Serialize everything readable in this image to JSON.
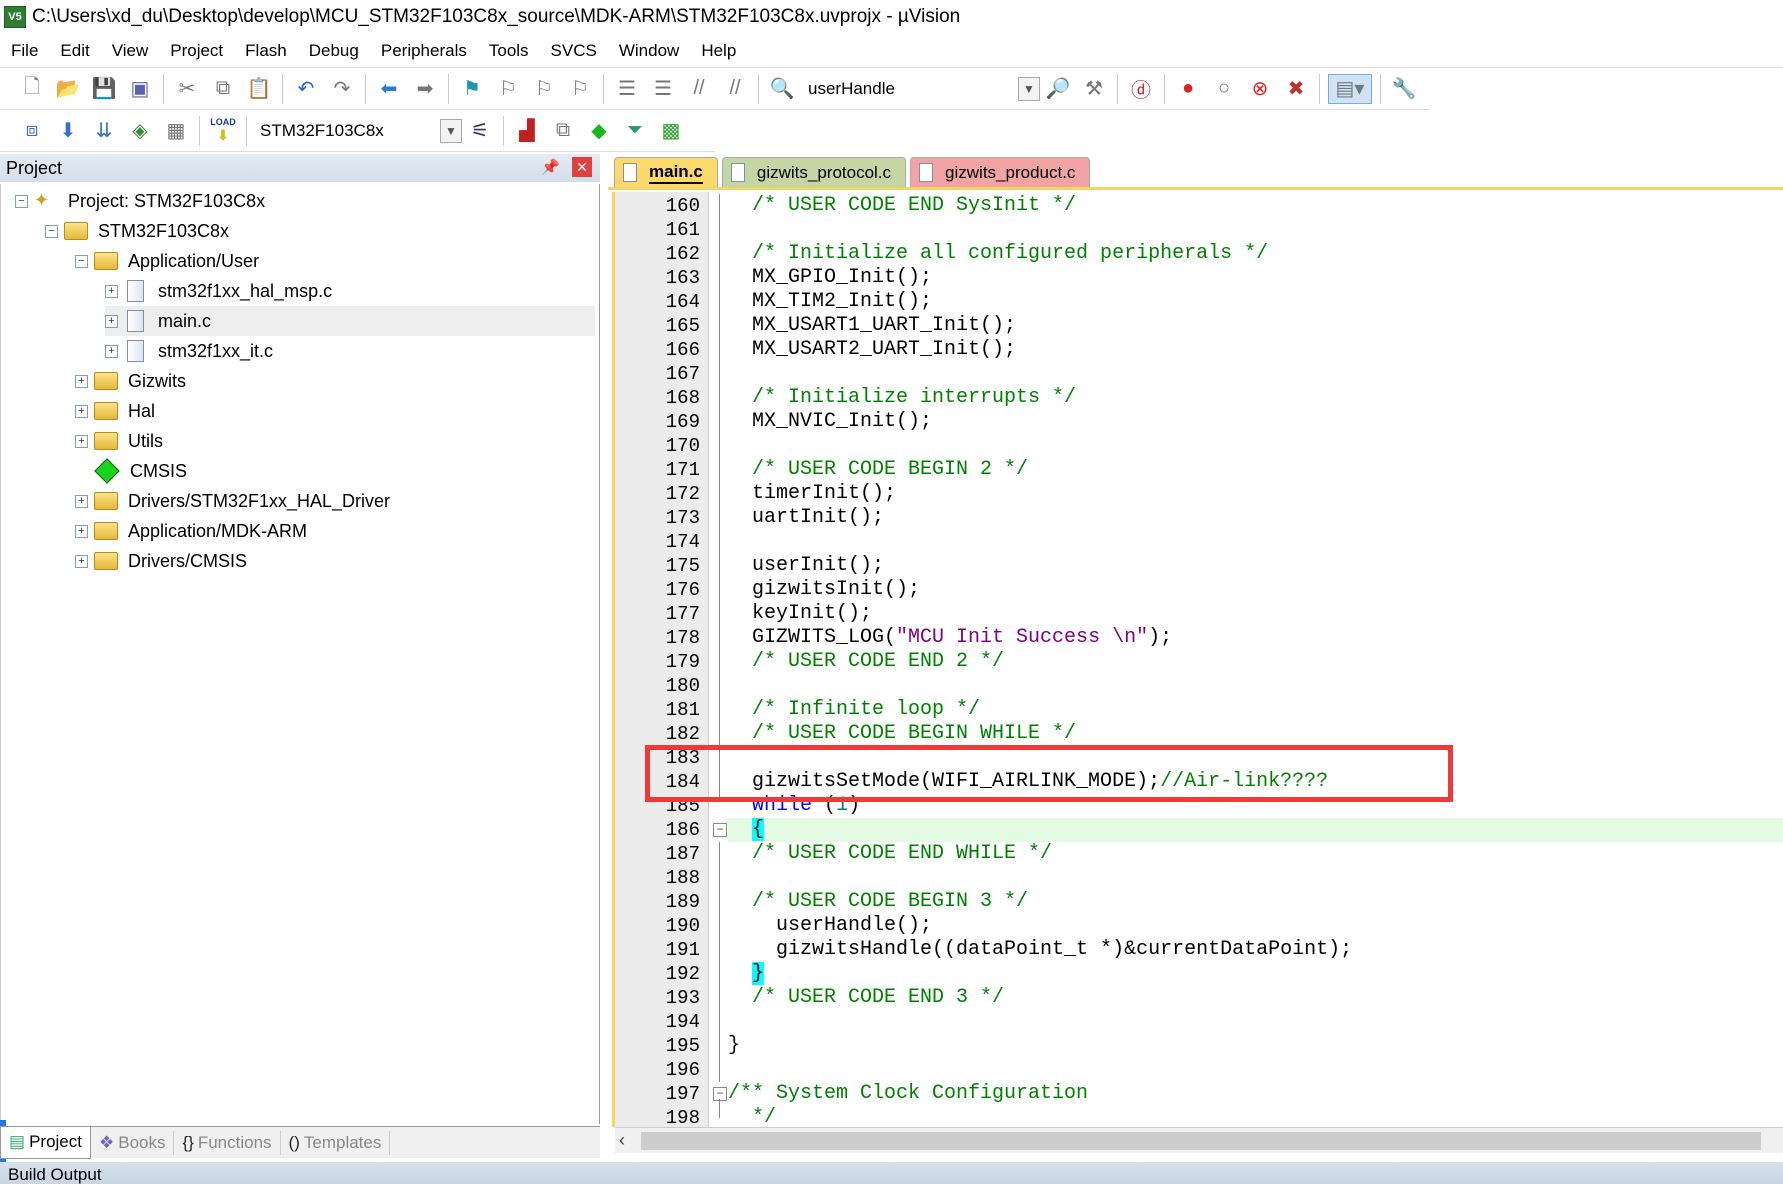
{
  "window": {
    "title": "C:\\Users\\xd_du\\Desktop\\develop\\MCU_STM32F103C8x_source\\MDK-ARM\\STM32F103C8x.uvprojx - µVision",
    "logo": "V5"
  },
  "menu": [
    "File",
    "Edit",
    "View",
    "Project",
    "Flash",
    "Debug",
    "Peripherals",
    "Tools",
    "SVCS",
    "Window",
    "Help"
  ],
  "toolbar1": {
    "find_combo": "userHandle"
  },
  "toolbar2": {
    "target_combo": "STM32F103C8x",
    "load_label": "LOAD"
  },
  "project_panel": {
    "title": "Project",
    "tree": [
      {
        "label": "Project: STM32F103C8x",
        "level": 0,
        "icon": "project-icon",
        "expander": "minus"
      },
      {
        "label": "STM32F103C8x",
        "level": 1,
        "icon": "target-folder-icon",
        "expander": "minus"
      },
      {
        "label": "Application/User",
        "level": 2,
        "icon": "folder-open-icon",
        "expander": "minus"
      },
      {
        "label": "stm32f1xx_hal_msp.c",
        "level": 3,
        "icon": "file-icon",
        "expander": "plus"
      },
      {
        "label": "main.c",
        "level": 3,
        "icon": "file-icon",
        "expander": "plus",
        "selected": true
      },
      {
        "label": "stm32f1xx_it.c",
        "level": 3,
        "icon": "file-icon",
        "expander": "plus"
      },
      {
        "label": "Gizwits",
        "level": 2,
        "icon": "folder-icon",
        "expander": "plus"
      },
      {
        "label": "Hal",
        "level": 2,
        "icon": "folder-icon",
        "expander": "plus"
      },
      {
        "label": "Utils",
        "level": 2,
        "icon": "folder-icon",
        "expander": "plus"
      },
      {
        "label": "CMSIS",
        "level": 2,
        "icon": "cmsis-diamond-icon",
        "expander": "none"
      },
      {
        "label": "Drivers/STM32F1xx_HAL_Driver",
        "level": 2,
        "icon": "folder-icon",
        "expander": "plus"
      },
      {
        "label": "Application/MDK-ARM",
        "level": 2,
        "icon": "folder-icon",
        "expander": "plus"
      },
      {
        "label": "Drivers/CMSIS",
        "level": 2,
        "icon": "folder-icon",
        "expander": "plus"
      }
    ],
    "bottom_tabs": [
      {
        "label": "Project",
        "icon": "project-tab-icon",
        "active": true
      },
      {
        "label": "Books",
        "icon": "books-icon"
      },
      {
        "label": "Functions",
        "icon": "braces-icon"
      },
      {
        "label": "Templates",
        "icon": "templates-icon"
      }
    ]
  },
  "editor_tabs": [
    {
      "label": "main.c",
      "color": "#fbd96b",
      "active": true
    },
    {
      "label": "gizwits_protocol.c",
      "color": "#c3d6a4"
    },
    {
      "label": "gizwits_product.c",
      "color": "#f2a3a3"
    }
  ],
  "code": [
    {
      "n": "160",
      "tokens": [
        [
          "  /* USER CODE END SysInit */",
          "comment"
        ]
      ]
    },
    {
      "n": "161",
      "tokens": []
    },
    {
      "n": "162",
      "tokens": [
        [
          "  /* Initialize all configured peripherals */",
          "comment"
        ]
      ]
    },
    {
      "n": "163",
      "tokens": [
        [
          "  MX_GPIO_Init();",
          ""
        ]
      ]
    },
    {
      "n": "164",
      "tokens": [
        [
          "  MX_TIM2_Init();",
          ""
        ]
      ]
    },
    {
      "n": "165",
      "tokens": [
        [
          "  MX_USART1_UART_Init();",
          ""
        ]
      ]
    },
    {
      "n": "166",
      "tokens": [
        [
          "  MX_USART2_UART_Init();",
          ""
        ]
      ]
    },
    {
      "n": "167",
      "tokens": []
    },
    {
      "n": "168",
      "tokens": [
        [
          "  /* Initialize interrupts */",
          "comment"
        ]
      ]
    },
    {
      "n": "169",
      "tokens": [
        [
          "  MX_NVIC_Init();",
          ""
        ]
      ]
    },
    {
      "n": "170",
      "tokens": []
    },
    {
      "n": "171",
      "tokens": [
        [
          "  /* USER CODE BEGIN 2 */",
          "comment"
        ]
      ]
    },
    {
      "n": "172",
      "tokens": [
        [
          "  timerInit();",
          ""
        ]
      ]
    },
    {
      "n": "173",
      "tokens": [
        [
          "  uartInit();",
          ""
        ]
      ]
    },
    {
      "n": "174",
      "tokens": []
    },
    {
      "n": "175",
      "tokens": [
        [
          "  userInit();",
          ""
        ]
      ]
    },
    {
      "n": "176",
      "tokens": [
        [
          "  gizwitsInit();",
          ""
        ]
      ]
    },
    {
      "n": "177",
      "tokens": [
        [
          "  keyInit();",
          ""
        ]
      ]
    },
    {
      "n": "178",
      "tokens": [
        [
          "  GIZWITS_LOG(",
          ""
        ],
        [
          "\"MCU Init Success \\n\"",
          "str"
        ],
        [
          ");",
          ""
        ]
      ]
    },
    {
      "n": "179",
      "tokens": [
        [
          "  /* USER CODE END 2 */",
          "comment"
        ]
      ]
    },
    {
      "n": "180",
      "tokens": []
    },
    {
      "n": "181",
      "tokens": [
        [
          "  /* Infinite loop */",
          "comment"
        ]
      ]
    },
    {
      "n": "182",
      "tokens": [
        [
          "  /* USER CODE BEGIN WHILE */",
          "comment"
        ]
      ]
    },
    {
      "n": "183",
      "tokens": []
    },
    {
      "n": "184",
      "tokens": [
        [
          "  gizwitsSetMode(WIFI_AIRLINK_MODE);",
          ""
        ],
        [
          "//Air-link????",
          "comment"
        ]
      ]
    },
    {
      "n": "185",
      "tokens": [
        [
          "  ",
          ""
        ],
        [
          "while",
          "kw"
        ],
        [
          " (",
          ""
        ],
        [
          "1",
          "num"
        ],
        [
          ")",
          ""
        ]
      ]
    },
    {
      "n": "186",
      "tokens": [
        [
          "  ",
          ""
        ],
        [
          "{",
          "brace"
        ]
      ],
      "current": true,
      "fold": "minus"
    },
    {
      "n": "187",
      "tokens": [
        [
          "  /* USER CODE END WHILE */",
          "comment"
        ]
      ]
    },
    {
      "n": "188",
      "tokens": []
    },
    {
      "n": "189",
      "tokens": [
        [
          "  /* USER CODE BEGIN 3 */",
          "comment"
        ]
      ]
    },
    {
      "n": "190",
      "tokens": [
        [
          "    userHandle();",
          ""
        ]
      ]
    },
    {
      "n": "191",
      "tokens": [
        [
          "    gizwitsHandle((dataPoint_t *)&currentDataPoint);",
          ""
        ]
      ]
    },
    {
      "n": "192",
      "tokens": [
        [
          "  ",
          ""
        ],
        [
          "}",
          "brace"
        ]
      ]
    },
    {
      "n": "193",
      "tokens": [
        [
          "  /* USER CODE END 3 */",
          "comment"
        ]
      ]
    },
    {
      "n": "194",
      "tokens": []
    },
    {
      "n": "195",
      "tokens": [
        [
          "}",
          ""
        ]
      ]
    },
    {
      "n": "196",
      "tokens": []
    },
    {
      "n": "197",
      "tokens": [
        [
          "/** System Clock Configuration",
          "comment"
        ]
      ],
      "fold": "minus"
    },
    {
      "n": "198",
      "tokens": [
        [
          "  */",
          "comment"
        ]
      ]
    }
  ],
  "annotation": {
    "highlight_color": "#f03a3a",
    "lines": [
      "183",
      "184"
    ]
  },
  "build_output": {
    "title": "Build Output"
  }
}
